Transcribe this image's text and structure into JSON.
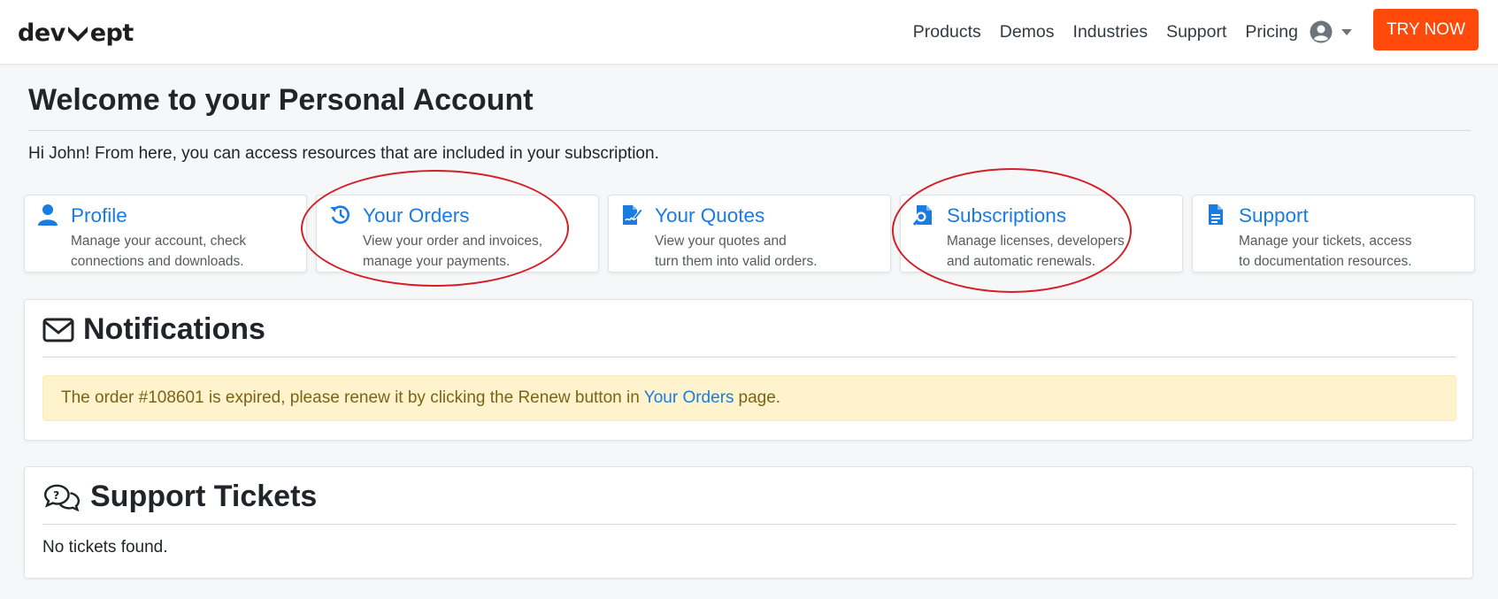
{
  "header": {
    "logo_left": "dev",
    "logo_right": "ept",
    "nav": [
      "Products",
      "Demos",
      "Industries",
      "Support",
      "Pricing"
    ],
    "try_now": "TRY NOW"
  },
  "main": {
    "title": "Welcome to your Personal Account",
    "subtitle": "Hi John! From here, you can access resources that are included in your subscription."
  },
  "cards": [
    {
      "title": "Profile",
      "desc1": "Manage your account, check",
      "desc2": "connections and downloads.",
      "icon": "user-icon"
    },
    {
      "title": "Your Orders",
      "desc1": "View your order and invoices,",
      "desc2": "manage your payments.",
      "icon": "history-icon"
    },
    {
      "title": "Your Quotes",
      "desc1": "View your quotes and",
      "desc2": "turn them into valid orders.",
      "icon": "file-signature-icon"
    },
    {
      "title": "Subscriptions",
      "desc1": "Manage licenses, developers",
      "desc2": "and automatic renewals.",
      "icon": "file-search-icon"
    },
    {
      "title": "Support",
      "desc1": "Manage your tickets, access",
      "desc2": "to documentation resources.",
      "icon": "document-icon"
    }
  ],
  "notifications": {
    "title": "Notifications",
    "alert_before": "The order #108601 is expired, please renew it by clicking the Renew button in",
    "alert_link": "Your Orders",
    "alert_after": "page."
  },
  "tickets": {
    "title": "Support Tickets",
    "empty": "No tickets found."
  },
  "colors": {
    "accent": "#1a7ce0",
    "try_button": "#ff4a0b",
    "annotation": "#d31f25",
    "alert_bg": "#fff3cd"
  }
}
